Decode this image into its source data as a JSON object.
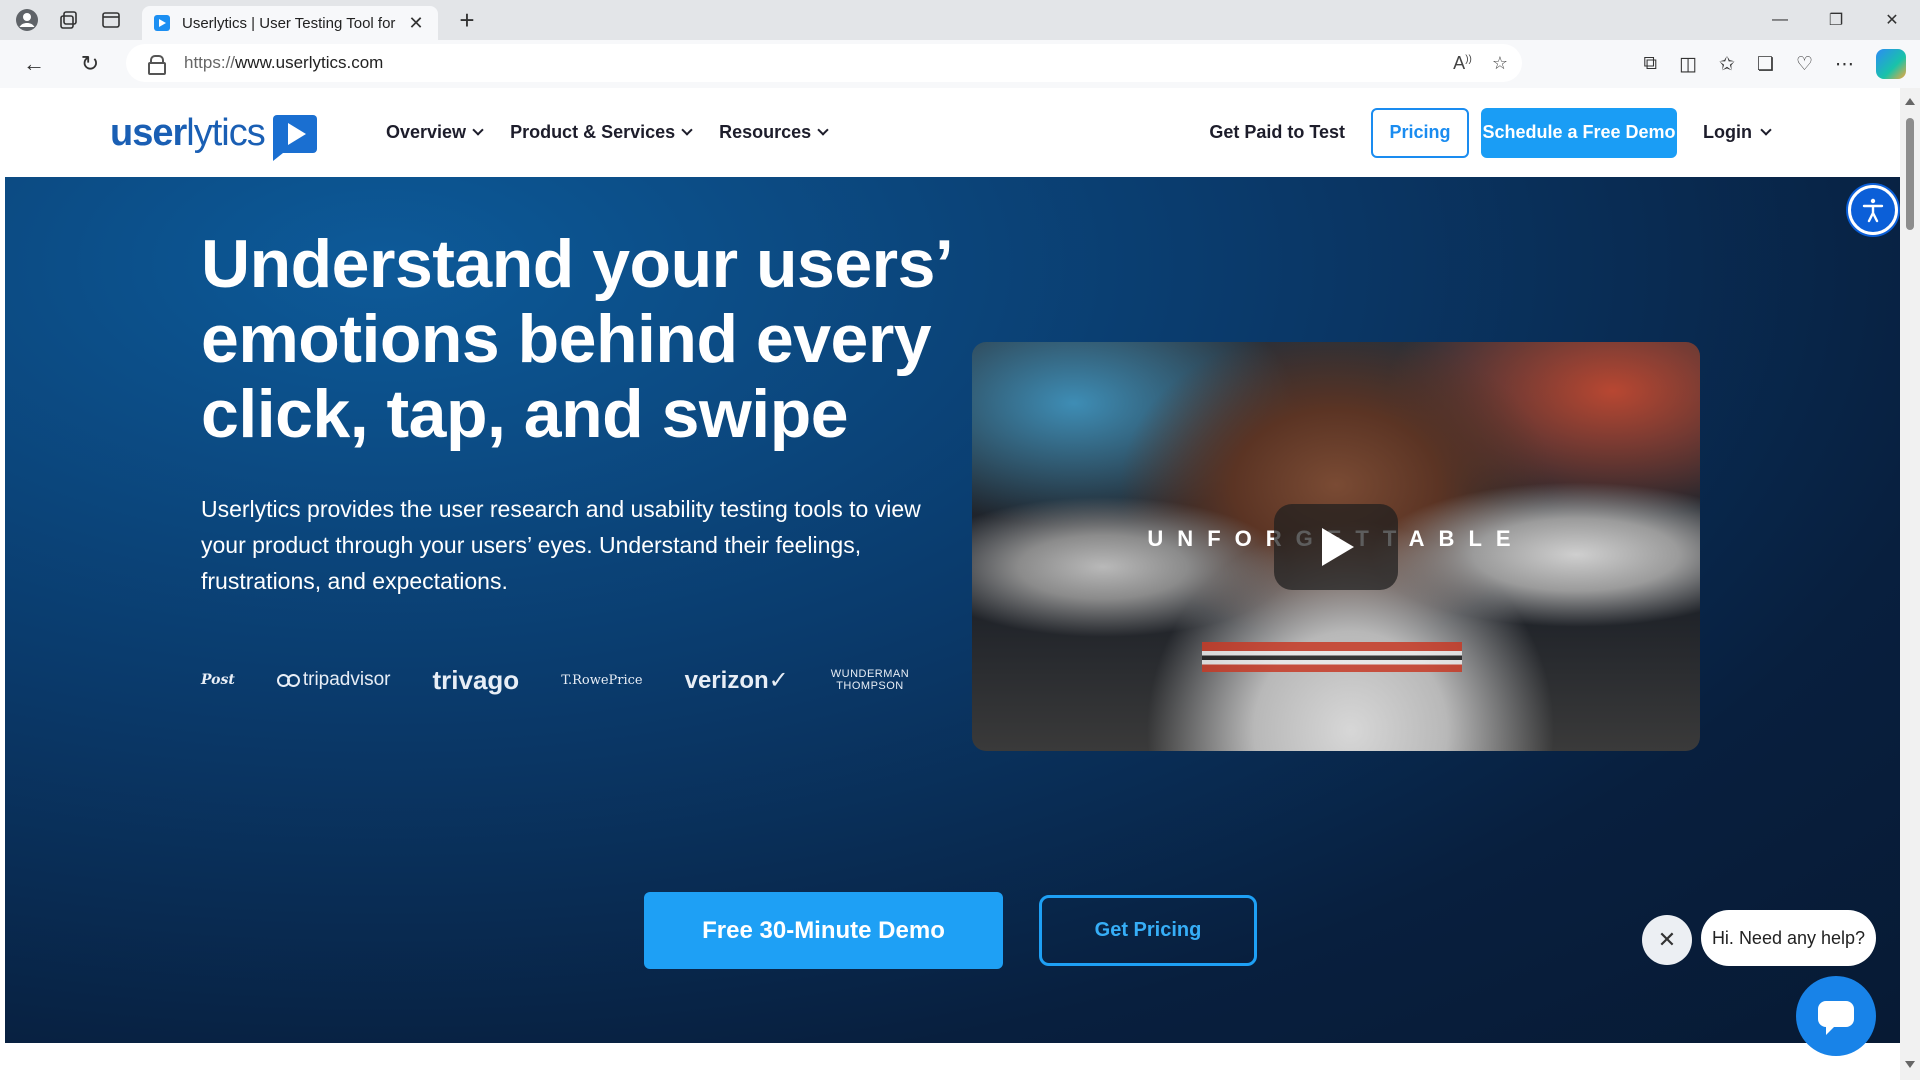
{
  "browser": {
    "tab_title": "Userlytics | User Testing Tool for ",
    "url_scheme": "https://",
    "url_host": "www.userlytics.com"
  },
  "header": {
    "logo_left": "user",
    "logo_bold": "lytics",
    "nav": [
      "Overview",
      "Product & Services",
      "Resources"
    ],
    "get_paid": "Get Paid to Test",
    "pricing": "Pricing",
    "schedule_demo": "Schedule a Free Demo",
    "login": "Login"
  },
  "hero": {
    "title": "Understand your users’ emotions behind every click, tap, and swipe",
    "description": "Userlytics provides the user research and usability testing tools to view your product through your users’ eyes. Understand their feelings, frustrations, and expectations.",
    "brands": {
      "post": "Post",
      "tripadvisor": "tripadvisor",
      "trivago": "trivago",
      "troweprice": "T.RowePrice",
      "verizon": "verizon✓",
      "wunderman_1": "WUNDERMAN",
      "wunderman_2": "THOMPSON"
    },
    "video_text": "UNFORGETTABLE",
    "cta_demo": "Free 30-Minute Demo",
    "cta_pricing": "Get Pricing"
  },
  "chat": {
    "bubble": "Hi. Need any help?"
  },
  "colors": {
    "accent": "#1a9df5",
    "hero_dark": "#081f3e",
    "logo_blue": "#1a5fb4"
  }
}
